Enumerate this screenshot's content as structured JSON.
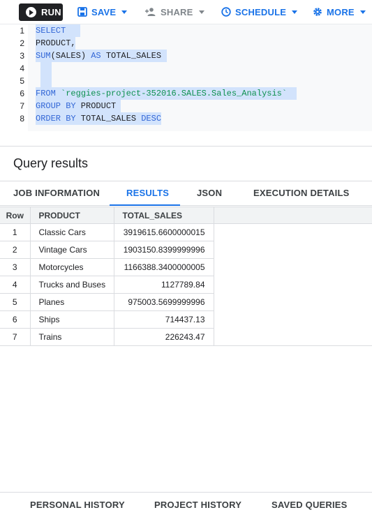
{
  "toolbar": {
    "run_label": "RUN",
    "save_label": "SAVE",
    "share_label": "SHARE",
    "schedule_label": "SCHEDULE",
    "more_label": "MORE"
  },
  "editor": {
    "lines": [
      {
        "n": "1",
        "tokens": [
          {
            "t": "SELECT",
            "c": "kw"
          }
        ]
      },
      {
        "n": "2",
        "tokens": [
          {
            "t": "PRODUCT,",
            "c": "plain"
          }
        ]
      },
      {
        "n": "3",
        "tokens": [
          {
            "t": "SUM",
            "c": "fn"
          },
          {
            "t": "(SALES) ",
            "c": "plain"
          },
          {
            "t": "AS",
            "c": "kw"
          },
          {
            "t": " TOTAL_SALES",
            "c": "plain"
          }
        ]
      },
      {
        "n": "4",
        "tokens": []
      },
      {
        "n": "5",
        "tokens": []
      },
      {
        "n": "6",
        "tokens": [
          {
            "t": "FROM",
            "c": "kw"
          },
          {
            "t": " ",
            "c": "plain"
          },
          {
            "t": "`reggies-project-352016.SALES.Sales_Analysis`",
            "c": "str"
          }
        ]
      },
      {
        "n": "7",
        "tokens": [
          {
            "t": "GROUP BY",
            "c": "kw"
          },
          {
            "t": " PRODUCT",
            "c": "plain"
          }
        ]
      },
      {
        "n": "8",
        "tokens": [
          {
            "t": "ORDER BY",
            "c": "kw"
          },
          {
            "t": " TOTAL_SALES ",
            "c": "plain"
          },
          {
            "t": "DESC",
            "c": "kw"
          }
        ]
      }
    ]
  },
  "results": {
    "title": "Query results",
    "tabs": [
      "JOB INFORMATION",
      "RESULTS",
      "JSON",
      "EXECUTION DETAILS"
    ],
    "active_tab": "RESULTS",
    "columns": [
      "Row",
      "PRODUCT",
      "TOTAL_SALES"
    ],
    "rows": [
      [
        "1",
        "Classic Cars",
        "3919615.6600000015"
      ],
      [
        "2",
        "Vintage Cars",
        "1903150.8399999996"
      ],
      [
        "3",
        "Motorcycles",
        "1166388.3400000005"
      ],
      [
        "4",
        "Trucks and Buses",
        "1127789.84"
      ],
      [
        "5",
        "Planes",
        "975003.5699999996"
      ],
      [
        "6",
        "Ships",
        "714437.13"
      ],
      [
        "7",
        "Trains",
        "226243.47"
      ]
    ]
  },
  "footer": {
    "personal_history": "PERSONAL HISTORY",
    "project_history": "PROJECT HISTORY",
    "saved_queries": "SAVED QUERIES"
  },
  "colors": {
    "accent": "#1a73e8",
    "selection": "#d2e3fc",
    "keyword": "#3367d6",
    "string": "#0d904f"
  }
}
